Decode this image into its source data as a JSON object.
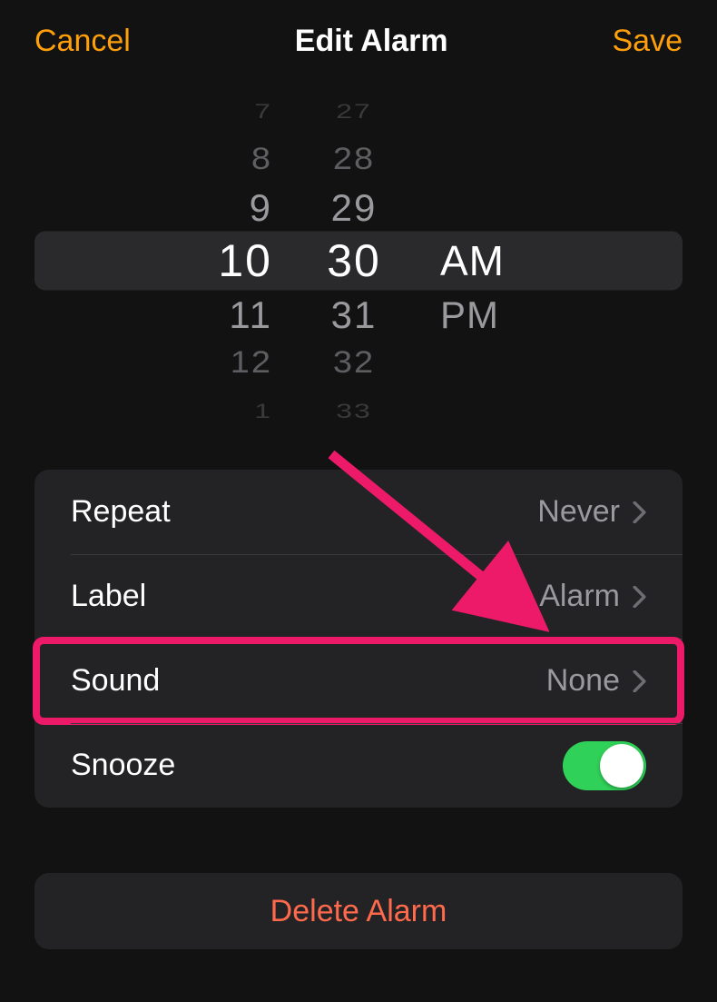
{
  "nav": {
    "cancel": "Cancel",
    "title": "Edit Alarm",
    "save": "Save"
  },
  "picker": {
    "hours": {
      "m3": "7",
      "m2": "8",
      "m1": "9",
      "sel": "10",
      "p1": "11",
      "p2": "12",
      "p3": "1"
    },
    "minutes": {
      "m3": "27",
      "m2": "28",
      "m1": "29",
      "sel": "30",
      "p1": "31",
      "p2": "32",
      "p3": "33"
    },
    "period": {
      "sel": "AM",
      "p1": "PM"
    }
  },
  "rows": {
    "repeat": {
      "label": "Repeat",
      "value": "Never"
    },
    "label": {
      "label": "Label",
      "value": "Alarm"
    },
    "sound": {
      "label": "Sound",
      "value": "None"
    },
    "snooze": {
      "label": "Snooze",
      "on": true
    }
  },
  "delete_label": "Delete Alarm"
}
